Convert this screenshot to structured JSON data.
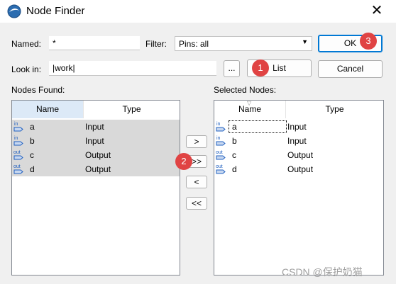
{
  "window": {
    "title": "Node Finder"
  },
  "named": {
    "label": "Named:",
    "value": "*"
  },
  "filter": {
    "label": "Filter:",
    "value": "Pins: all"
  },
  "look_in": {
    "label": "Look in:",
    "value": "|work|",
    "browse_label": "..."
  },
  "buttons": {
    "ok": "OK",
    "list": "List",
    "cancel": "Cancel",
    "add": ">",
    "add_all": ">>",
    "remove": "<",
    "remove_all": "<<"
  },
  "nodes_found": {
    "label": "Nodes Found:",
    "columns": [
      "Name",
      "Type"
    ],
    "rows": [
      {
        "icon": "in",
        "name": "a",
        "type": "Input"
      },
      {
        "icon": "in",
        "name": "b",
        "type": "Input"
      },
      {
        "icon": "out",
        "name": "c",
        "type": "Output"
      },
      {
        "icon": "out",
        "name": "d",
        "type": "Output"
      }
    ]
  },
  "selected_nodes": {
    "label": "Selected Nodes:",
    "columns": [
      "Name",
      "Type"
    ],
    "rows": [
      {
        "icon": "in",
        "name": "a",
        "type": "Input"
      },
      {
        "icon": "in",
        "name": "b",
        "type": "Input"
      },
      {
        "icon": "out",
        "name": "c",
        "type": "Output"
      },
      {
        "icon": "out",
        "name": "d",
        "type": "Output"
      }
    ]
  },
  "annotations": {
    "step1": "1",
    "step2": "2",
    "step3": "3"
  },
  "watermark": "CSDN @保护奶猫",
  "colors": {
    "badge": "#e04343",
    "accent": "#0078d4",
    "selection": "#d9d9d9",
    "header_active": "#dce9f7"
  }
}
